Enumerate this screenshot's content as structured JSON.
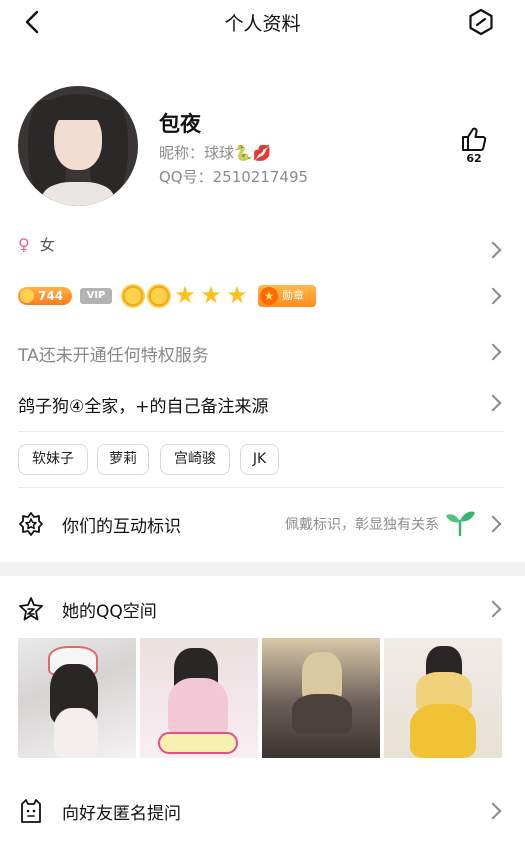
{
  "header": {
    "title": "个人资料"
  },
  "profile": {
    "name": "包夜",
    "nickname": "昵称：球球🐍💋",
    "qq": "QQ号：2510217495",
    "likes": "62"
  },
  "gender": {
    "symbol": "♀",
    "label": "女"
  },
  "badges": {
    "level": "744",
    "vip": "VIP",
    "medal": "勋章",
    "medal_star": "★",
    "star": "★"
  },
  "privilege_text": "TA还未开通任何特权服务",
  "remark_text": "鸽子狗④全家，+的自己备注来源",
  "tags": [
    "软妹子",
    "萝莉",
    "宫崎骏",
    "JK"
  ],
  "interaction": {
    "label": "你们的互动标识",
    "hint": "佩戴标识，彰显独有关系"
  },
  "qzone": {
    "label": "她的QQ空间"
  },
  "anon": {
    "label": "向好友匿名提问"
  },
  "colors": {
    "accent_orange": "#ff8a1f",
    "gender_pink": "#e8668a",
    "star_gold": "#ffc21a",
    "sprout_green": "#3cb371"
  }
}
